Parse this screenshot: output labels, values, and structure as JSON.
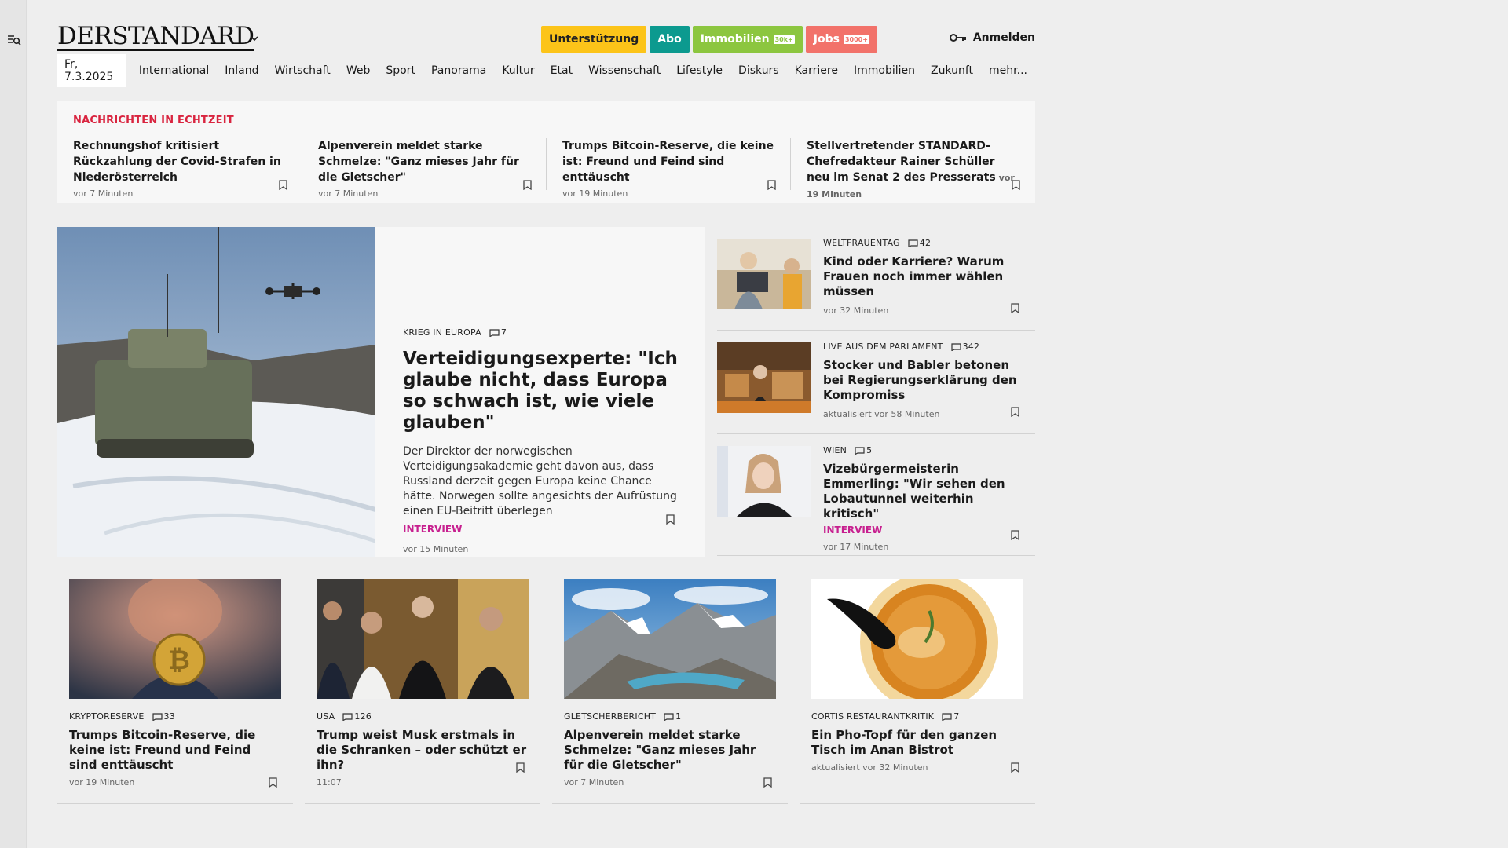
{
  "sidebar": {
    "toggle_icon": "menu-search-icon"
  },
  "header": {
    "logo": "DERSTANDARD",
    "services": [
      {
        "label": "Unterstützung",
        "badge": ""
      },
      {
        "label": "Abo",
        "badge": ""
      },
      {
        "label": "Immobilien",
        "badge": "30k+"
      },
      {
        "label": "Jobs",
        "badge": "3000+"
      }
    ],
    "login_label": "Anmelden",
    "login_icon": "key-icon"
  },
  "nav": {
    "date": "Fr, 7.3.2025",
    "items": [
      "International",
      "Inland",
      "Wirtschaft",
      "Web",
      "Sport",
      "Panorama",
      "Kultur",
      "Etat",
      "Wissenschaft",
      "Lifestyle",
      "Diskurs",
      "Karriere",
      "Immobilien",
      "Zukunft",
      "mehr..."
    ]
  },
  "ticker": {
    "label": "NACHRICHTEN IN ECHTZEIT",
    "items": [
      {
        "title": "Rechnungshof kritisiert Rückzahlung der Covid-Strafen in Niederösterreich",
        "time": "vor 7 Minuten"
      },
      {
        "title": "Alpenverein meldet starke Schmelze: \"Ganz mieses Jahr für die Gletscher\"",
        "time": "vor 7 Minuten"
      },
      {
        "title": "Trumps Bitcoin-Reserve, die keine ist: Freund und Feind sind enttäuscht",
        "time": "vor 19 Minuten"
      },
      {
        "title": "Stellvertretender STANDARD-Chefredakteur Rainer Schüller neu im Senat 2 des Presserats",
        "time": "vor 19 Minuten"
      }
    ]
  },
  "lead": {
    "kicker": "KRIEG IN EUROPA",
    "comments": "7",
    "title": "Verteidigungsexperte: \"Ich glaube nicht, dass Europa so schwach ist, wie viele glauben\"",
    "teaser": "Der Direktor der norwegischen Verteidigungsakademie geht davon aus, dass Russland derzeit gegen Europa keine Chance hätte. Norwegen sollte angesichts der Aufrüstung einen EU-Beitritt überlegen",
    "tag": "INTERVIEW",
    "time": "vor 15 Minuten"
  },
  "side": [
    {
      "kicker": "WELTFRAUENTAG",
      "comments": "42",
      "title": "Kind oder Karriere? Warum Frauen noch immer wählen müssen",
      "tag": "",
      "time": "vor 32 Minuten"
    },
    {
      "kicker": "LIVE AUS DEM PARLAMENT",
      "comments": "342",
      "title": "Stocker und Babler betonen bei Regierungserklärung den Kompromiss",
      "tag": "",
      "time": "aktualisiert vor 58 Minuten"
    },
    {
      "kicker": "WIEN",
      "comments": "5",
      "title": "Vizebürgermeisterin Emmerling: \"Wir sehen den Lobautunnel weiterhin kritisch\"",
      "tag": "INTERVIEW",
      "time": "vor 17 Minuten"
    }
  ],
  "cards": [
    {
      "kicker": "KRYPTORESERVE",
      "comments": "33",
      "title": "Trumps Bitcoin-Reserve, die keine ist: Freund und Feind sind enttäuscht",
      "time": "vor 19 Minuten"
    },
    {
      "kicker": "USA",
      "comments": "126",
      "title": "Trump weist Musk erstmals in die Schranken – oder schützt er ihn?",
      "time": "11:07"
    },
    {
      "kicker": "GLETSCHERBERICHT",
      "comments": "1",
      "title": "Alpenverein meldet starke Schmelze: \"Ganz mieses Jahr für die Gletscher\"",
      "time": "vor 7 Minuten"
    },
    {
      "kicker": "CORTIS RESTAURANTKRITIK",
      "comments": "7",
      "title": "Ein Pho-Topf für den ganzen Tisch im Anan Bistrot",
      "time": "aktualisiert vor 32 Minuten"
    }
  ],
  "colors": {
    "ticker_label": "#d9243f",
    "interview_tag": "#c71f8f",
    "support": "#fcc419",
    "abo": "#0c9a8f",
    "immobilien": "#8cc63f",
    "jobs": "#f2726a"
  }
}
